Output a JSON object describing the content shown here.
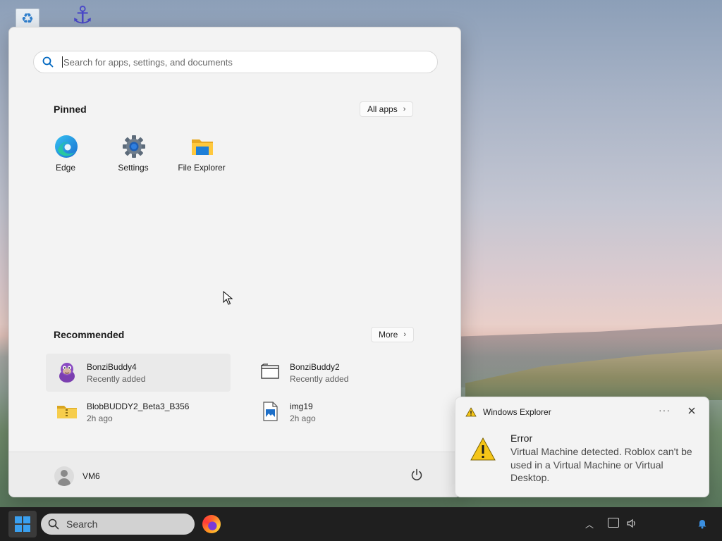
{
  "start_menu": {
    "search": {
      "placeholder": "Search for apps, settings, and documents"
    },
    "pinned": {
      "title": "Pinned",
      "all_apps_label": "All apps",
      "apps": [
        {
          "label": "Edge",
          "icon": "edge-icon"
        },
        {
          "label": "Settings",
          "icon": "gear-icon"
        },
        {
          "label": "File Explorer",
          "icon": "folder-icon"
        }
      ]
    },
    "recommended": {
      "title": "Recommended",
      "more_label": "More",
      "items": [
        {
          "name": "BonziBuddy4",
          "sub": "Recently added",
          "icon": "bonzi-icon"
        },
        {
          "name": "BonziBuddy2",
          "sub": "Recently added",
          "icon": "window-app-icon"
        },
        {
          "name": "BlobBUDDY2_Beta3_B356",
          "sub": "2h ago",
          "icon": "zip-folder-icon"
        },
        {
          "name": "img19",
          "sub": "2h ago",
          "icon": "image-file-icon"
        }
      ]
    },
    "user": {
      "name": "VM6"
    }
  },
  "notification": {
    "app_name": "Windows Explorer",
    "title": "Error",
    "message": "Virtual Machine detected. Roblox can't be used in a Virtual Machine or Virtual Desktop."
  },
  "taskbar": {
    "search_label": "Search"
  },
  "colors": {
    "accent": "#0078d4",
    "start_bg": "#f3f3f3",
    "taskbar_bg": "#1f1f1f",
    "warning": "#f5c518"
  }
}
